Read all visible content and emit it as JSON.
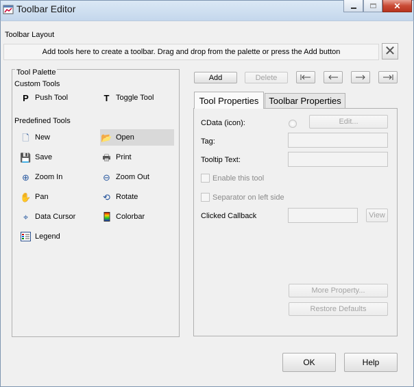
{
  "window": {
    "title": "Toolbar Editor",
    "minimize_icon": "minimize-icon",
    "maximize_icon": "maximize-icon",
    "close_label": "✕"
  },
  "layout_section": {
    "title": "Toolbar Layout",
    "instructions": "Add tools here to create a toolbar. Drag and drop from the palette or press the Add button",
    "clear_icon": "✕"
  },
  "palette": {
    "title": "Tool Palette",
    "custom_title": "Custom Tools",
    "custom_tools": [
      {
        "label": "Push Tool",
        "icon": "push-tool-icon",
        "glyph": "P"
      },
      {
        "label": "Toggle Tool",
        "icon": "toggle-tool-icon",
        "glyph": "T"
      }
    ],
    "predefined_title": "Predefined Tools",
    "predefined_tools": [
      {
        "label": "New",
        "icon": "new-file-icon",
        "glyph": "🗋"
      },
      {
        "label": "Open",
        "icon": "open-folder-icon",
        "glyph": "📂",
        "selected": true
      },
      {
        "label": "Save",
        "icon": "save-icon",
        "glyph": "💾"
      },
      {
        "label": "Print",
        "icon": "printer-icon",
        "glyph": "🖶"
      },
      {
        "label": "Zoom In",
        "icon": "zoom-in-icon",
        "glyph": "⊕"
      },
      {
        "label": "Zoom Out",
        "icon": "zoom-out-icon",
        "glyph": "⊖"
      },
      {
        "label": "Pan",
        "icon": "pan-hand-icon",
        "glyph": "✋"
      },
      {
        "label": "Rotate",
        "icon": "rotate-icon",
        "glyph": "⟲"
      },
      {
        "label": "Data Cursor",
        "icon": "data-cursor-icon",
        "glyph": "⌖"
      },
      {
        "label": "Colorbar",
        "icon": "colorbar-icon",
        "glyph": "▮"
      },
      {
        "label": "Legend",
        "icon": "legend-icon",
        "glyph": "☰"
      }
    ]
  },
  "toolbar_buttons": {
    "add": "Add",
    "delete": "Delete",
    "move_first_icon": "move-first-icon",
    "move_left_icon": "move-left-icon",
    "move_right_icon": "move-right-icon",
    "move_last_icon": "move-last-icon"
  },
  "tabs": [
    {
      "label": "Tool Properties",
      "active": true
    },
    {
      "label": "Toolbar Properties",
      "active": false
    }
  ],
  "tool_properties": {
    "cdata_label": "CData (icon):",
    "edit_button": "Edit...",
    "tag_label": "Tag:",
    "tag_value": "",
    "tooltip_label": "Tooltip Text:",
    "tooltip_value": "",
    "enable_label": "Enable this tool",
    "separator_label": "Separator on left side",
    "callback_label": "Clicked Callback",
    "callback_value": "",
    "view_button": "View",
    "more_property_button": "More Property...",
    "restore_defaults_button": "Restore Defaults"
  },
  "footer": {
    "ok": "OK",
    "help": "Help"
  }
}
